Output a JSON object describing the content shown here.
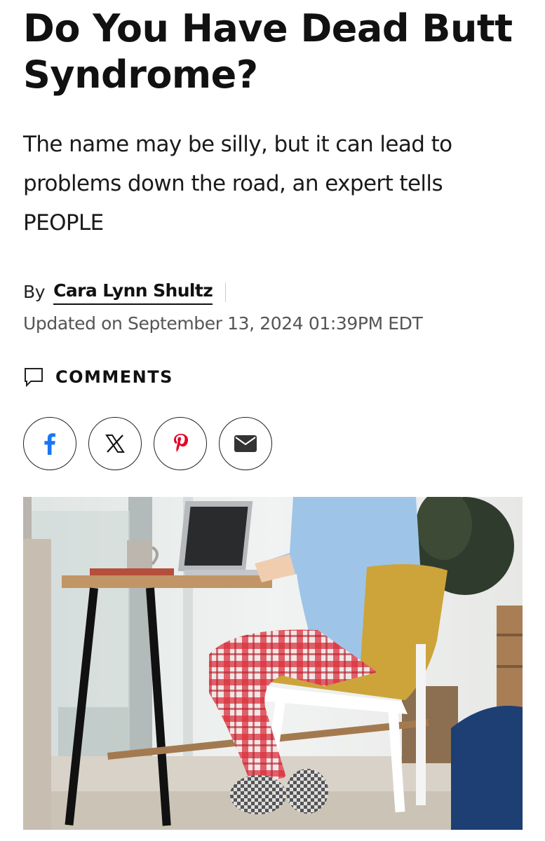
{
  "article": {
    "headline": "Do You Have Dead Butt Syndrome?",
    "dek": "The name may be silly, but it can lead to problems down the road, an expert tells PEOPLE",
    "byline": {
      "prefix": "By",
      "author": "Cara Lynn Shultz"
    },
    "updated": "Updated on September 13, 2024 01:39PM EDT",
    "comments_label": "COMMENTS"
  },
  "share": {
    "buttons": [
      {
        "icon": "facebook-icon",
        "color": "#1877f2"
      },
      {
        "icon": "x-icon",
        "color": "#111111"
      },
      {
        "icon": "pinterest-icon",
        "color": "#e60023"
      },
      {
        "icon": "email-icon",
        "color": "#333333"
      }
    ]
  },
  "hero_image": {
    "description_icon": "photo-woman-at-laptop-desk"
  }
}
